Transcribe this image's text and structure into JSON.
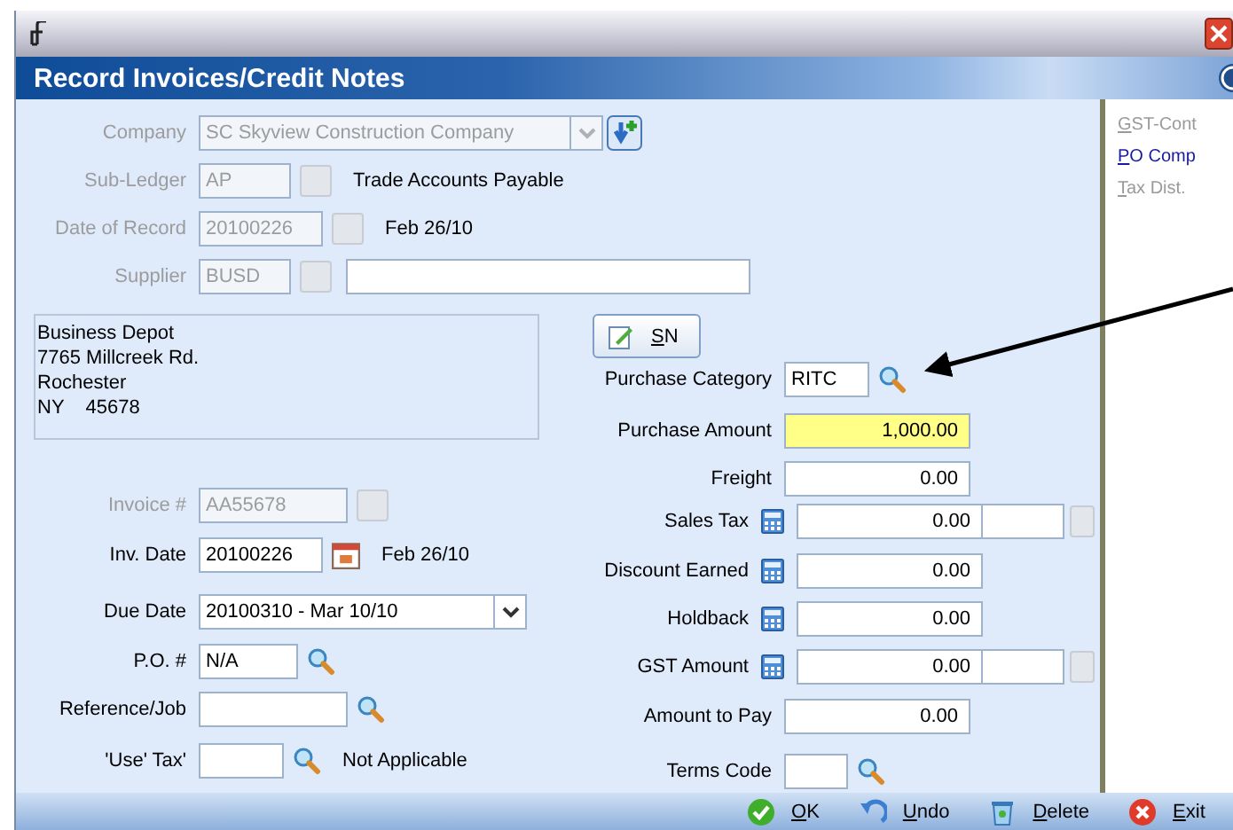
{
  "window": {
    "title": "Record Invoices/Credit Notes"
  },
  "header_fields": [
    {
      "label": "Company",
      "value": "SC Skyview Construction Company",
      "kind": "dropdown",
      "disabled": true
    },
    {
      "label": "Sub-Ledger",
      "value": "AP",
      "kind": "lookup",
      "disabled": true,
      "description": "Trade Accounts Payable"
    },
    {
      "label": "Date of Record",
      "value": "20100226",
      "kind": "date",
      "disabled": true,
      "description": "Feb 26/10"
    },
    {
      "label": "Supplier",
      "value": "BUSD",
      "kind": "lookup-name",
      "disabled": true
    }
  ],
  "address": [
    "Business Depot",
    "7765 Millcreek Rd.",
    "Rochester",
    "NY    45678"
  ],
  "sn_button": {
    "label": "SN"
  },
  "left_fields": [
    {
      "label": "Invoice #",
      "value": "AA55678",
      "kind": "lookup",
      "disabled": true
    },
    {
      "label": "Inv. Date",
      "value": "20100226",
      "kind": "date",
      "disabled": false,
      "description": "Feb 26/10"
    },
    {
      "label": "Due Date",
      "value": "20100310 - Mar 10/10",
      "kind": "dropdown",
      "disabled": false
    },
    {
      "label": "P.O. #",
      "value": "N/A",
      "kind": "search",
      "disabled": false
    },
    {
      "label": "Reference/Job",
      "kind": "search",
      "disabled": false
    },
    {
      "label": "'Use' Tax'",
      "kind": "search",
      "disabled": false,
      "description": "Not Applicable"
    }
  ],
  "right_fields": [
    {
      "label": "Purchase Category",
      "value": "RITC",
      "kind": "search",
      "highlighted": false
    },
    {
      "label": "Purchase Amount",
      "value": "1,000.00",
      "kind": "amount",
      "highlighted": true
    },
    {
      "label": "Freight",
      "value": "0.00",
      "kind": "amount",
      "highlighted": false
    },
    {
      "label": "Sales Tax",
      "value": "0.00",
      "kind": "calc-split",
      "highlighted": false
    },
    {
      "label": "Discount Earned",
      "value": "0.00",
      "kind": "calc",
      "highlighted": false
    },
    {
      "label": "Holdback",
      "value": "0.00",
      "kind": "calc",
      "highlighted": false
    },
    {
      "label": "GST Amount",
      "value": "0.00",
      "kind": "calc-split",
      "highlighted": false
    },
    {
      "label": "Amount to Pay",
      "value": "0.00",
      "kind": "amount",
      "highlighted": false
    },
    {
      "label": "Terms Code",
      "kind": "search",
      "highlighted": false
    }
  ],
  "sidebar": {
    "items": [
      {
        "label": "GST-Cont",
        "disabled": true
      },
      {
        "label": "PO Comp",
        "disabled": false
      },
      {
        "label": "Tax Dist.",
        "disabled": true
      }
    ]
  },
  "footer_buttons": [
    {
      "label": "OK",
      "kind": "ok"
    },
    {
      "label": "Undo",
      "kind": "undo"
    },
    {
      "label": "Delete",
      "kind": "delete"
    },
    {
      "label": "Exit",
      "kind": "exit"
    }
  ]
}
